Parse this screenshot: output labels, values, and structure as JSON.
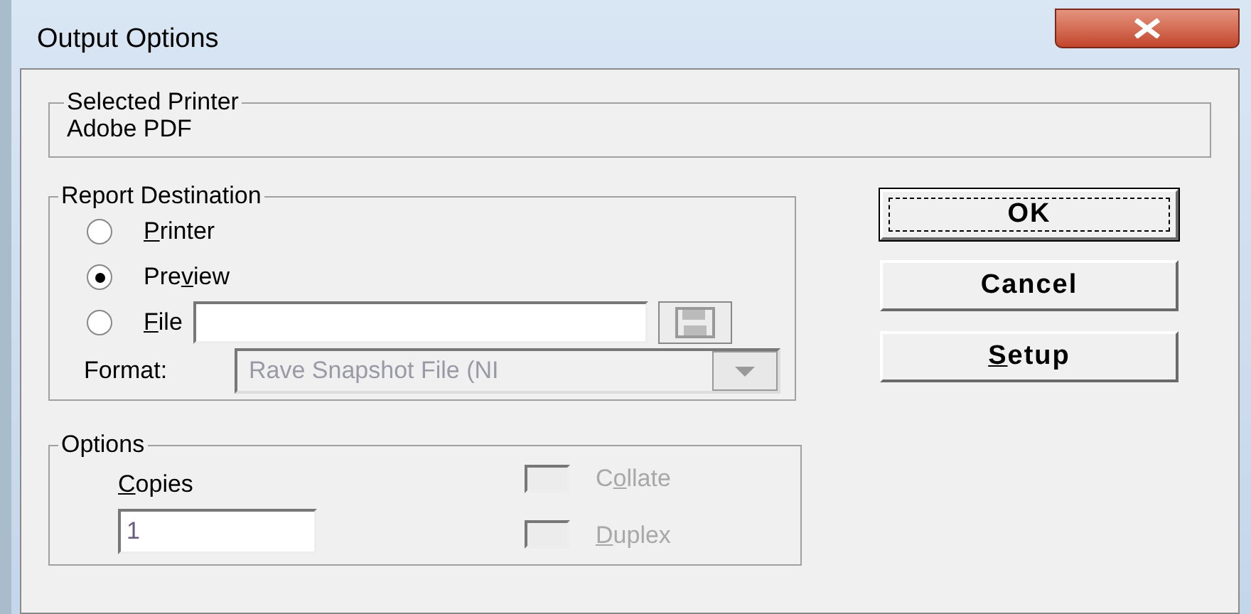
{
  "window": {
    "title": "Output Options"
  },
  "selected_printer": {
    "legend": "Selected Printer",
    "value": "Adobe PDF"
  },
  "report_destination": {
    "legend": "Report Destination",
    "options": [
      {
        "kind": "radio",
        "label": {
          "key": "P",
          "post": "rinter"
        },
        "selected": false
      },
      {
        "kind": "radio",
        "label": {
          "pre": "Pre",
          "key": "v",
          "post": "iew"
        },
        "selected": true
      },
      {
        "kind": "file",
        "label": {
          "key": "F",
          "post": "ile"
        },
        "selected": false
      }
    ],
    "format": {
      "label": "Format:",
      "value": "Rave Snapshot File (NI",
      "disabled": true
    }
  },
  "options": {
    "legend": "Options",
    "copies": {
      "label": {
        "key": "C",
        "post": "opies"
      },
      "value": "1"
    },
    "checkboxes": [
      {
        "label": {
          "pre": "C",
          "key": "o",
          "post": "llate"
        },
        "checked": false,
        "disabled": true
      },
      {
        "label": {
          "key": "D",
          "post": "uplex"
        },
        "checked": false,
        "disabled": true
      }
    ]
  },
  "buttons": [
    {
      "label": {
        "post": "OK"
      },
      "default": true
    },
    {
      "label": {
        "post": "Cancel"
      },
      "default": false
    },
    {
      "label": {
        "key": "S",
        "post": "etup"
      },
      "default": false
    }
  ]
}
